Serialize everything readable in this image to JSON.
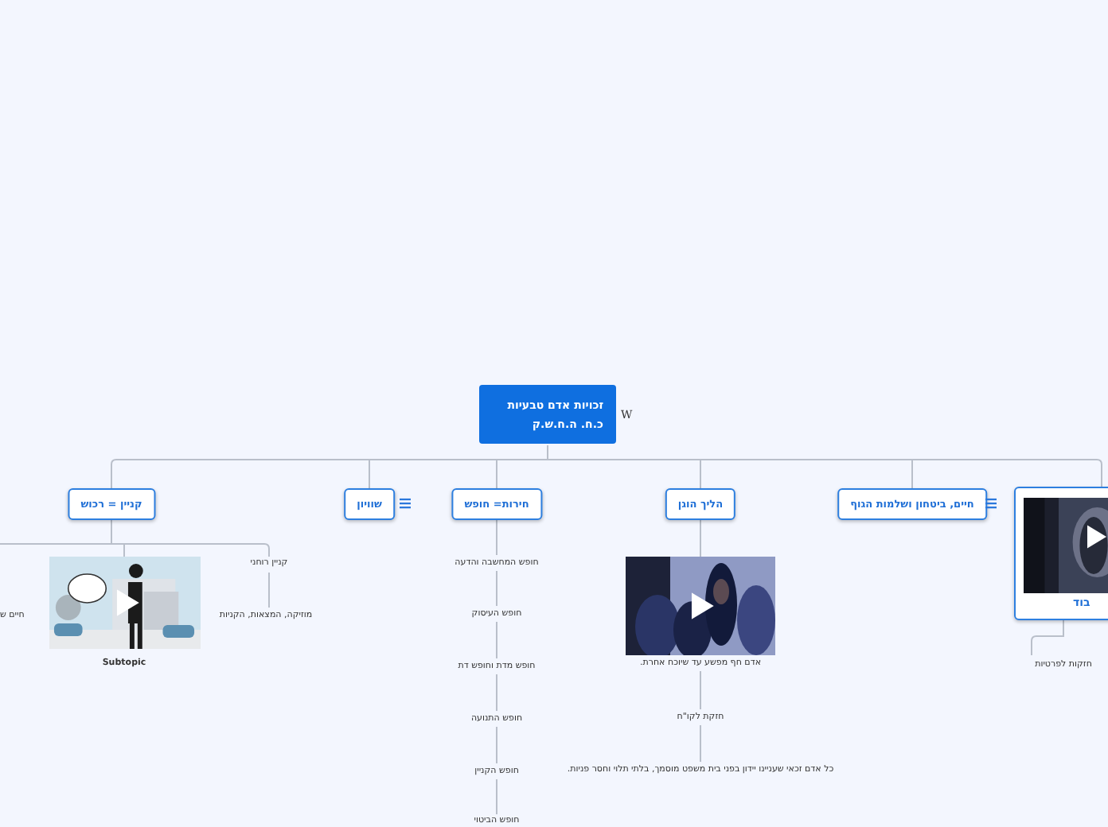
{
  "central": {
    "title": "זכויות אדם טבעיות",
    "subtitle": "כ.ח. ה.ח.ש.ק",
    "marker": "W"
  },
  "branches": [
    {
      "kind": "picture",
      "label": "בוד",
      "notes": false,
      "children": [
        {
          "kind": "text",
          "text": "חזקות לפרטיות"
        }
      ]
    },
    {
      "kind": "topic",
      "label": "חיים, ביטחון ושלמות הגוף",
      "notes": true
    },
    {
      "kind": "topic",
      "label": "הליך הוגן",
      "notes": false,
      "children": [
        {
          "kind": "picture",
          "text": "אדם חף מפשע עד שיוכח אחרת."
        },
        {
          "kind": "text",
          "text": "חזקת לקו\"ח"
        },
        {
          "kind": "text",
          "text": "כל אדם זכאי שעניינו יידון בפני בית משפט מוסמך, בלתי תלוי וחסר פניות."
        }
      ]
    },
    {
      "kind": "topic",
      "label": "חירות= חופש",
      "notes": false,
      "children": [
        {
          "kind": "text",
          "text": "חופש המחשבה והדעה"
        },
        {
          "kind": "text",
          "text": "חופש העיסוק"
        },
        {
          "kind": "text",
          "text": "חופש מדת וחופש דת"
        },
        {
          "kind": "text",
          "text": "חופש התנועה"
        },
        {
          "kind": "text",
          "text": "חופש הקניין"
        },
        {
          "kind": "text",
          "text": "חופש הביטוי"
        }
      ]
    },
    {
      "kind": "topic",
      "label": "שוויון",
      "notes": true
    },
    {
      "kind": "topic",
      "label": "קניין = רכוש",
      "notes": false,
      "children": [
        {
          "kind": "text",
          "text": "קניין רוחני"
        },
        {
          "kind": "text",
          "text": "מוזיקה, המצאות, הקניות"
        },
        {
          "kind": "picture",
          "text": "Subtopic"
        },
        {
          "kind": "text",
          "text": "חיים ש"
        }
      ]
    }
  ]
}
